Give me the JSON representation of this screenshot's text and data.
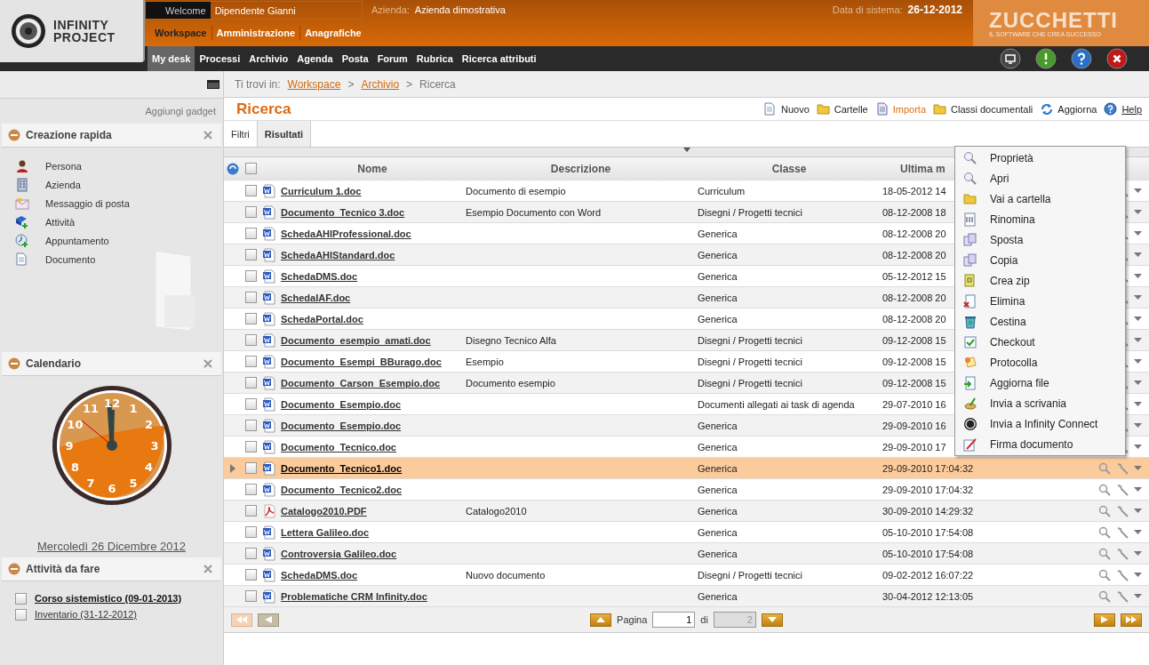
{
  "header": {
    "logo_text": [
      "INFINITY",
      "PROJECT"
    ],
    "welcome_label": "Welcome",
    "user": "Dipendente Gianni",
    "company_label": "Azienda:",
    "company": "Azienda dimostrativa",
    "date_label": "Data di sistema:",
    "date": "26-12-2012",
    "brand": "ZUCCHETTI",
    "brand_tagline": "IL SOFTWARE CHE CREA SUCCESSO"
  },
  "main_menu": [
    {
      "label": "Workspace",
      "selected": true
    },
    {
      "label": "Amministrazione",
      "selected": false
    },
    {
      "label": "Anagrafiche",
      "selected": false
    }
  ],
  "nav": [
    {
      "label": "My desk",
      "selected": true
    },
    {
      "label": "Processi",
      "selected": false
    },
    {
      "label": "Archivio",
      "selected": false
    },
    {
      "label": "Agenda",
      "selected": false
    },
    {
      "label": "Posta",
      "selected": false
    },
    {
      "label": "Forum",
      "selected": false
    },
    {
      "label": "Rubrica",
      "selected": false
    },
    {
      "label": "Ricerca attributi",
      "selected": false
    }
  ],
  "nav_icons": [
    {
      "kind": "monitor"
    },
    {
      "kind": "info"
    },
    {
      "kind": "help"
    },
    {
      "kind": "close"
    }
  ],
  "sidebar": {
    "add_gadget": "Aggiungi gadget",
    "quick_create": {
      "title": "Creazione rapida",
      "items": [
        {
          "label": "Persona",
          "kind": "person"
        },
        {
          "label": "Azienda",
          "kind": "building"
        },
        {
          "label": "Messaggio di posta",
          "kind": "mail"
        },
        {
          "label": "Attività",
          "kind": "task"
        },
        {
          "label": "Appuntamento",
          "kind": "appointment"
        },
        {
          "label": "Documento",
          "kind": "document"
        }
      ]
    },
    "calendar": {
      "title": "Calendario",
      "clock_numerals": [
        "12",
        "11",
        "1",
        "10",
        "2",
        "9",
        "3",
        "8",
        "4",
        "7",
        "5",
        "6"
      ],
      "date": "Mercoledì 26 Dicembre 2012"
    },
    "todo": {
      "title": "Attività da fare",
      "items": [
        {
          "label": "Corso sistemistico (09-01-2013)",
          "checked": false,
          "bold": true
        },
        {
          "label": "Inventario (31-12-2012)",
          "checked": false,
          "bold": false
        }
      ]
    }
  },
  "breadcrumb": {
    "label": "Ti trovi in:",
    "items": [
      {
        "label": "Workspace",
        "link": true
      },
      {
        "label": "Archivio",
        "link": true
      },
      {
        "label": "Ricerca",
        "link": false
      }
    ],
    "separator": ">"
  },
  "page_title": "Ricerca",
  "toolbar": [
    {
      "label": "Nuovo",
      "kind": "document",
      "highlighted": false
    },
    {
      "label": "Cartelle",
      "kind": "folder",
      "highlighted": false
    },
    {
      "label": "Importa",
      "kind": "import",
      "highlighted": true
    },
    {
      "label": "Classi documentali",
      "kind": "folder",
      "highlighted": false
    },
    {
      "label": "Aggiorna",
      "kind": "refresh",
      "highlighted": false
    },
    {
      "label": "Help",
      "kind": "help",
      "highlighted": false
    }
  ],
  "tabs": [
    {
      "label": "Filtri",
      "selected": false
    },
    {
      "label": "Risultati",
      "selected": true
    }
  ],
  "table": {
    "select_all_checked": false,
    "columns": [
      "Nome",
      "Descrizione",
      "Classe",
      "Ultima m"
    ],
    "rows": [
      {
        "name": "Curriculum 1.doc",
        "description": "Documento di esempio",
        "class": "Curriculum",
        "modified": "18-05-2012 14",
        "kind": "doc",
        "checked": false,
        "selected": false
      },
      {
        "name": "Documento_Tecnico 3.doc",
        "description": "Esempio Documento con Word",
        "class": "Disegni / Progetti tecnici",
        "modified": "08-12-2008 18",
        "kind": "doc",
        "checked": false,
        "selected": false
      },
      {
        "name": "SchedaAHIProfessional.doc",
        "class": "Generica",
        "modified": "08-12-2008 20",
        "kind": "doc",
        "checked": false,
        "selected": false
      },
      {
        "name": "SchedaAHIStandard.doc",
        "class": "Generica",
        "modified": "08-12-2008 20",
        "kind": "doc",
        "checked": false,
        "selected": false
      },
      {
        "name": "SchedaDMS.doc",
        "class": "Generica",
        "modified": "05-12-2012 15",
        "kind": "doc",
        "checked": false,
        "selected": false
      },
      {
        "name": "SchedaIAF.doc",
        "class": "Generica",
        "modified": "08-12-2008 20",
        "kind": "doc",
        "checked": false,
        "selected": false
      },
      {
        "name": "SchedaPortal.doc",
        "class": "Generica",
        "modified": "08-12-2008 20",
        "kind": "doc",
        "checked": false,
        "selected": false
      },
      {
        "name": "Documento_esempio_amati.doc",
        "description": "Disegno Tecnico Alfa",
        "class": "Disegni / Progetti tecnici",
        "modified": "09-12-2008 15",
        "kind": "doc",
        "checked": false,
        "selected": false
      },
      {
        "name": "Documento_Esempi_BBurago.doc",
        "description": "Esempio",
        "class": "Disegni / Progetti tecnici",
        "modified": "09-12-2008 15",
        "kind": "doc",
        "checked": false,
        "selected": false
      },
      {
        "name": "Documento_Carson_Esempio.doc",
        "description": "Documento esempio",
        "class": "Disegni / Progetti tecnici",
        "modified": "09-12-2008 15",
        "kind": "doc",
        "checked": false,
        "selected": false
      },
      {
        "name": "Documento_Esempio.doc",
        "class": "Documenti allegati ai task di agenda",
        "modified": "29-07-2010 16",
        "kind": "doc",
        "checked": false,
        "selected": false
      },
      {
        "name": "Documento_Esempio.doc",
        "class": "Generica",
        "modified": "29-09-2010 16",
        "kind": "doc",
        "checked": false,
        "selected": false
      },
      {
        "name": "Documento_Tecnico.doc",
        "class": "Generica",
        "modified": "29-09-2010 17",
        "kind": "doc",
        "checked": false,
        "selected": false
      },
      {
        "name": "Documento_Tecnico1.doc",
        "class": "Generica",
        "modified": "29-09-2010 17:04:32",
        "kind": "doc",
        "checked": false,
        "selected": true
      },
      {
        "name": "Documento_Tecnico2.doc",
        "class": "Generica",
        "modified": "29-09-2010 17:04:32",
        "kind": "doc",
        "checked": false,
        "selected": false
      },
      {
        "name": "Catalogo2010.PDF",
        "description": "Catalogo2010",
        "class": "Generica",
        "modified": "30-09-2010 14:29:32",
        "kind": "pdf",
        "checked": false,
        "selected": false
      },
      {
        "name": "Lettera Galileo.doc",
        "class": "Generica",
        "modified": "05-10-2010 17:54:08",
        "kind": "doc",
        "checked": false,
        "selected": false
      },
      {
        "name": "Controversia Galileo.doc",
        "class": "Generica",
        "modified": "05-10-2010 17:54:08",
        "kind": "doc",
        "checked": false,
        "selected": false
      },
      {
        "name": "SchedaDMS.doc",
        "description": "Nuovo documento",
        "class": "Disegni / Progetti tecnici",
        "modified": "09-02-2012 16:07:22",
        "kind": "doc",
        "checked": false,
        "selected": false
      },
      {
        "name": "Problematiche CRM Infinity.doc",
        "class": "Generica",
        "modified": "30-04-2012 12:13:05",
        "kind": "doc",
        "checked": false,
        "selected": false
      }
    ]
  },
  "pagination": {
    "page_label": "Pagina",
    "page": "1",
    "of_label": "di",
    "total": "2"
  },
  "context_menu": [
    {
      "label": "Proprietà",
      "kind": "magnifier"
    },
    {
      "label": "Apri",
      "kind": "magnifier"
    },
    {
      "label": "Vai a cartella",
      "kind": "folder"
    },
    {
      "label": "Rinomina",
      "kind": "rename"
    },
    {
      "label": "Sposta",
      "kind": "copy"
    },
    {
      "label": "Copia",
      "kind": "copy"
    },
    {
      "label": "Crea zip",
      "kind": "zip"
    },
    {
      "label": "Elimina",
      "kind": "delete"
    },
    {
      "label": "Cestina",
      "kind": "trash"
    },
    {
      "label": "Checkout",
      "kind": "check"
    },
    {
      "label": "Protocolla",
      "kind": "stamp"
    },
    {
      "label": "Aggiorna file",
      "kind": "update"
    },
    {
      "label": "Invia a scrivania",
      "kind": "send"
    },
    {
      "label": "Invia a Infinity Connect",
      "kind": "swirl"
    },
    {
      "label": "Firma documento",
      "kind": "sign"
    }
  ]
}
